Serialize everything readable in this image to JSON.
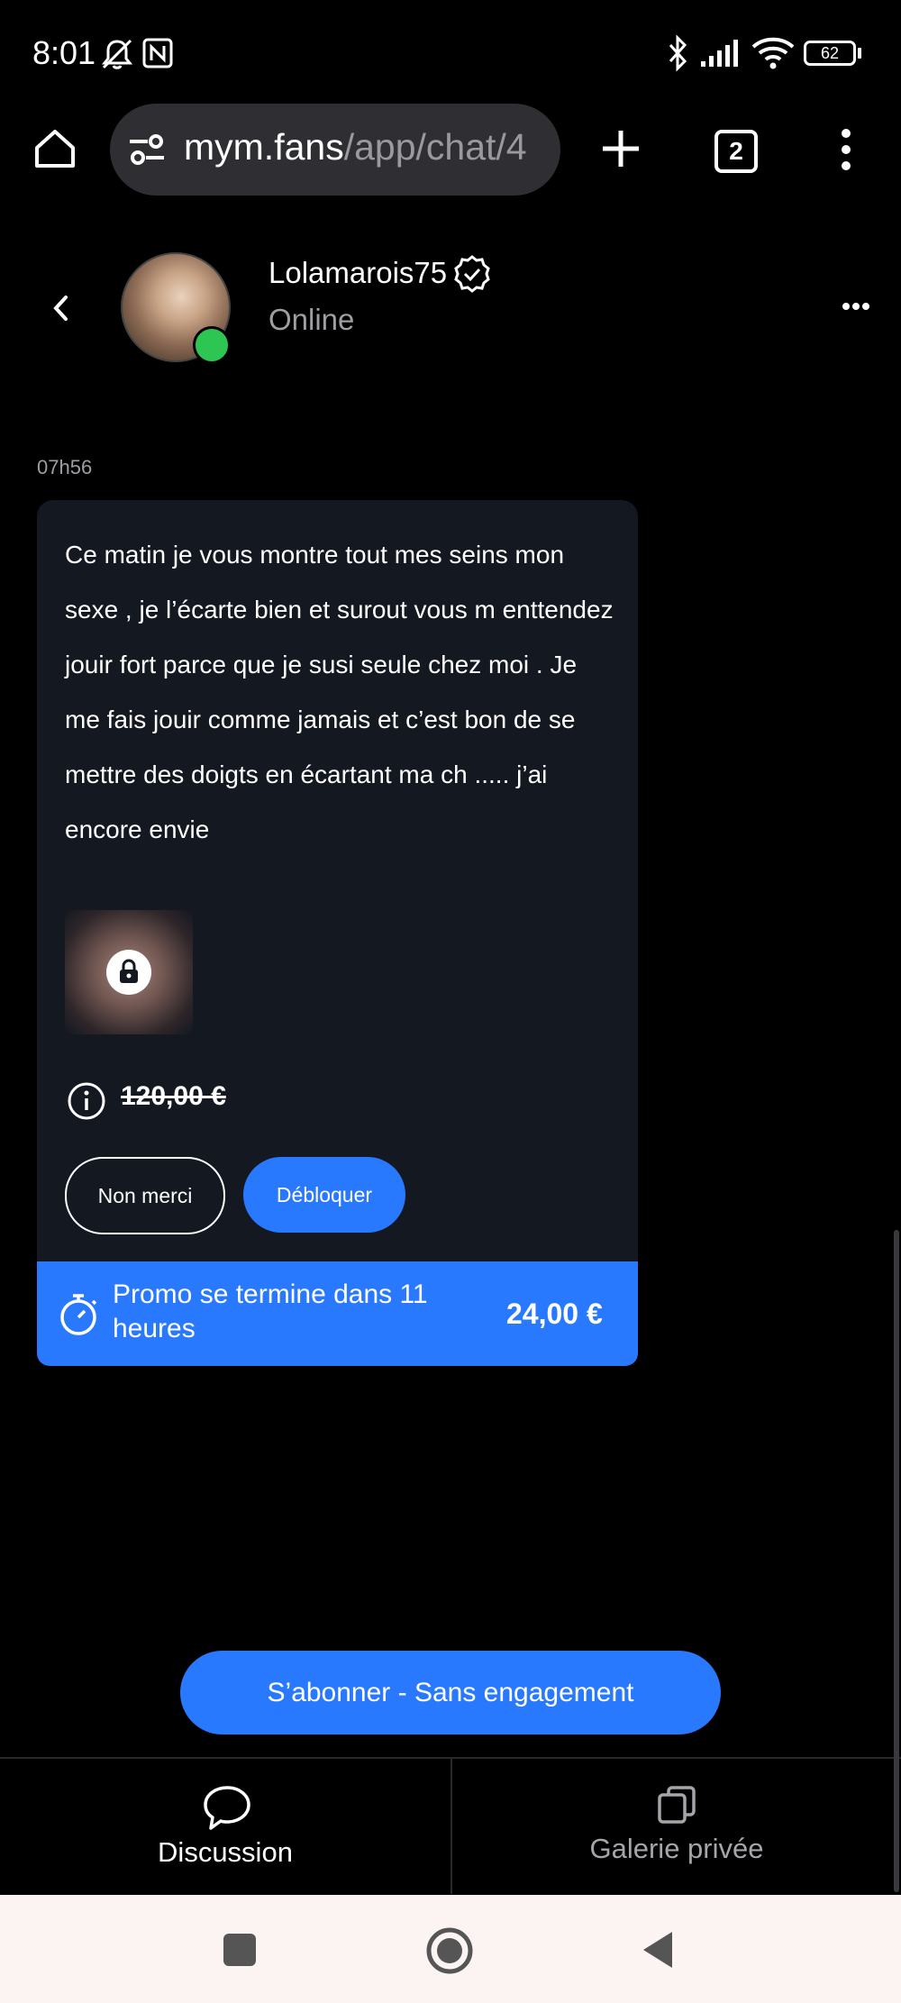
{
  "status_bar": {
    "time": "8:01",
    "battery": "62",
    "icons": [
      "mute-bell-icon",
      "nfc-icon",
      "bluetooth-icon",
      "signal-icon",
      "wifi-icon",
      "battery-icon"
    ]
  },
  "browser": {
    "url_host": "mym.fans",
    "url_path": "/app/chat/4",
    "tab_count": "2"
  },
  "chat_header": {
    "username": "Lolamarois75",
    "status": "Online"
  },
  "message": {
    "timestamp": "07h56",
    "text": "Ce matin je vous montre tout mes seins mon sexe , je l’écarte bien et surout vous m enttendez jouir fort parce que je susi seule chez moi . Je me fais jouir comme jamais et c’est bon de se mettre des doigts en écartant ma ch ..... j’ai encore envie",
    "original_price": "120,00 €",
    "decline_label": "Non merci",
    "unlock_label": "Débloquer",
    "promo_text": "Promo se termine dans 11 heures",
    "promo_price": "24,00 €"
  },
  "subscribe_label": "S’abonner - Sans engagement",
  "tabs": [
    {
      "label": "Discussion",
      "active": true
    },
    {
      "label": "Galerie privée",
      "active": false
    }
  ],
  "colors": {
    "accent": "#2979ff",
    "online": "#2dc653",
    "card": "#141821",
    "background": "#000000"
  }
}
